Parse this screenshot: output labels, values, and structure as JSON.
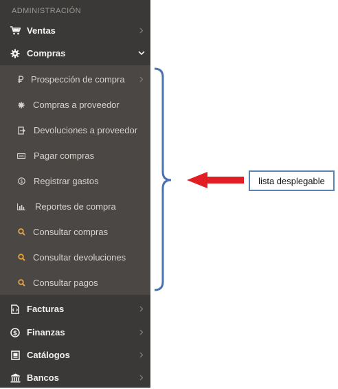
{
  "sidebar": {
    "section_title": "ADMINISTRACIÓN",
    "items": [
      {
        "label": "Ventas",
        "icon": "cart-icon"
      },
      {
        "label": "Compras",
        "icon": "gear-icon",
        "expanded": true
      },
      {
        "label": "Facturas",
        "icon": "invoice-icon"
      },
      {
        "label": "Finanzas",
        "icon": "dollar-circle-icon"
      },
      {
        "label": "Catálogos",
        "icon": "catalog-book-icon"
      },
      {
        "label": "Bancos",
        "icon": "bank-icon"
      }
    ],
    "submenu": [
      {
        "label": "Prospección de compra",
        "icon": "ruble-icon"
      },
      {
        "label": "Compras a proveedor",
        "icon": "gear-icon"
      },
      {
        "label": "Devoluciones a proveedor",
        "icon": "return-icon"
      },
      {
        "label": "Pagar compras",
        "icon": "money-bill-icon"
      },
      {
        "label": "Registrar gastos",
        "icon": "dollar-circle-icon"
      },
      {
        "label": "Reportes de compra",
        "icon": "bar-chart-icon"
      },
      {
        "label": "Consultar compras",
        "icon": "search-icon"
      },
      {
        "label": "Consultar devoluciones",
        "icon": "search-icon"
      },
      {
        "label": "Consultar pagos",
        "icon": "search-icon"
      }
    ]
  },
  "annotation": {
    "label": "lista desplegable"
  },
  "colors": {
    "sidebar_bg": "#3b3937",
    "submenu_bg": "#4a4745",
    "search_icon": "#e8a33a",
    "arrow": "#e01e24",
    "bracket": "#4a72b0"
  }
}
